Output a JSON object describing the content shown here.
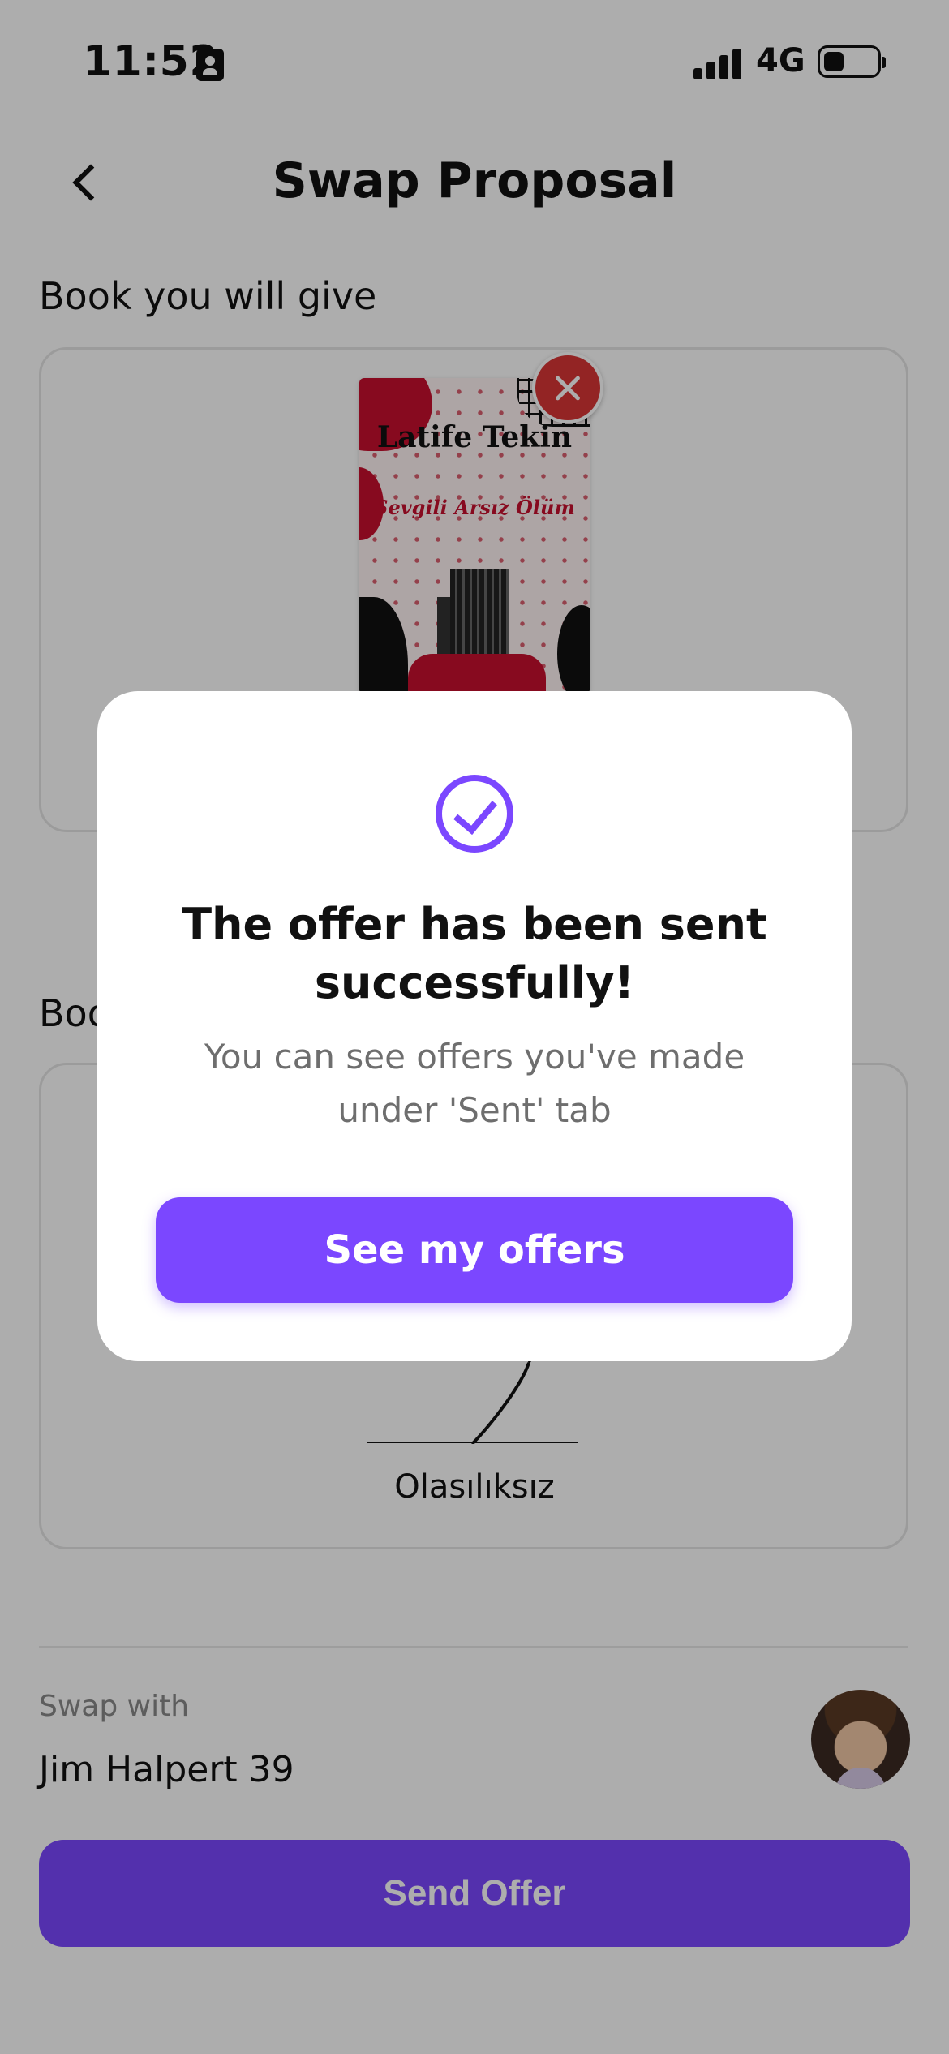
{
  "status_bar": {
    "time": "11:52",
    "network": "4G",
    "battery_icon": "battery-icon",
    "signal_icon": "signal-icon"
  },
  "header": {
    "title": "Swap Proposal",
    "back_icon": "chevron-left-icon"
  },
  "give_section": {
    "label": "Book you will give",
    "book": {
      "cover_author": "Latife Tekin",
      "cover_subtitle": "Sevgili Arsız Ölüm"
    }
  },
  "receive_section": {
    "label": "Boo",
    "book": {
      "title": "Olasılıksız"
    }
  },
  "swap_with": {
    "label": "Swap with",
    "user": "Jim Halpert 39"
  },
  "send_button": {
    "label": "Send Offer"
  },
  "modal": {
    "icon": "check-circle-icon",
    "title": "The offer has been sent successfully!",
    "message": "You can see offers you've made under 'Sent' tab",
    "button_label": "See my offers"
  },
  "colors": {
    "accent": "#7b47ff",
    "remove": "#d93636",
    "overlay": "rgba(0,0,0,0.32)"
  }
}
